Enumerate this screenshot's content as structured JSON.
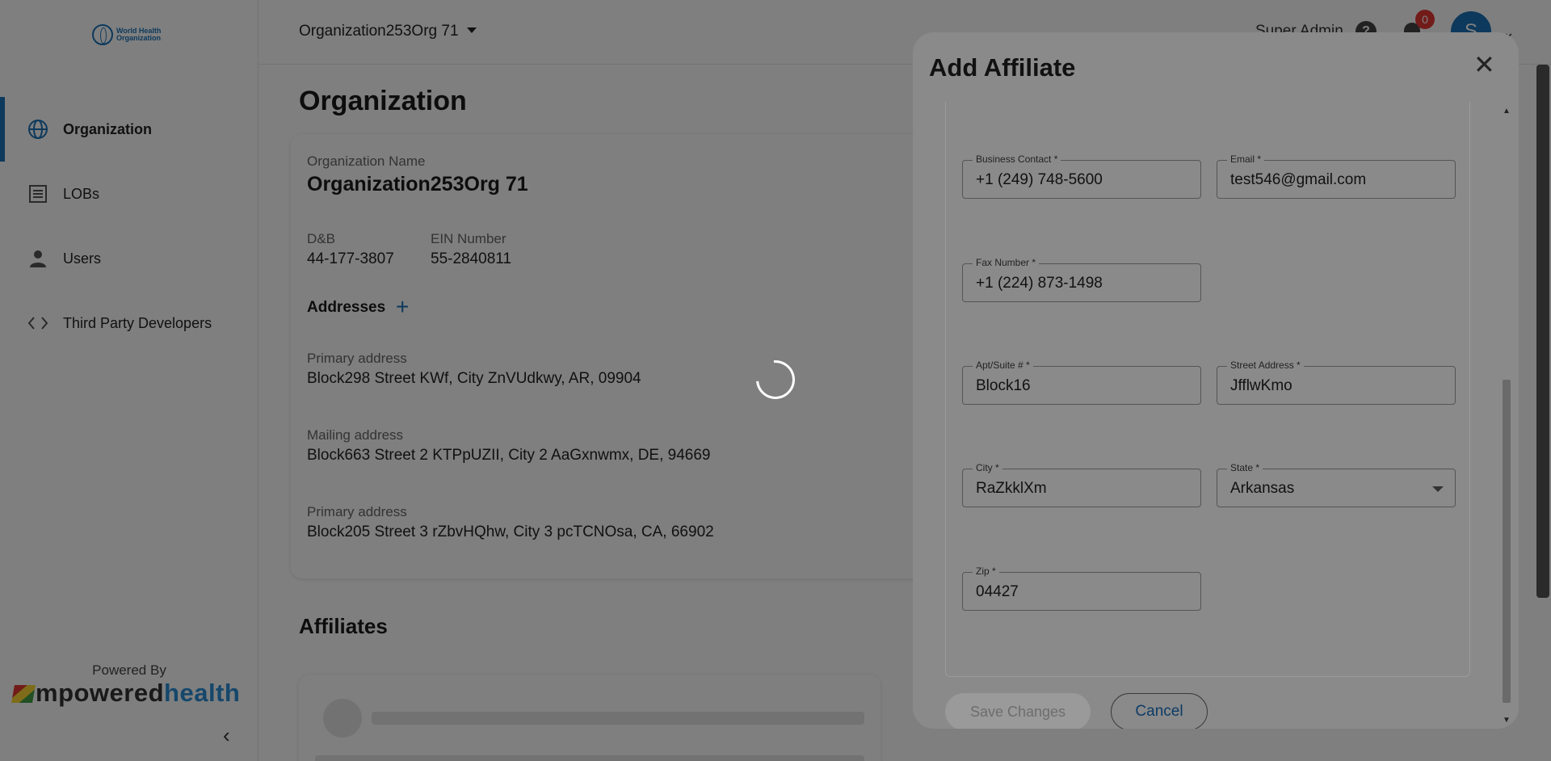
{
  "sidebar": {
    "logo_text": "World Health Organization",
    "items": [
      {
        "label": "Organization",
        "icon": "globe-icon",
        "active": true
      },
      {
        "label": "LOBs",
        "icon": "list-icon",
        "active": false
      },
      {
        "label": "Users",
        "icon": "user-icon",
        "active": false
      },
      {
        "label": "Third Party Developers",
        "icon": "code-icon",
        "active": false
      }
    ],
    "powered_by": "Powered By",
    "brand_m": "mpowered",
    "brand_h": "health",
    "collapse_icon": "‹"
  },
  "topbar": {
    "org_select": "Organization253Org 71",
    "role": "Super Admin",
    "help_icon": "?",
    "notifications_count": "0",
    "avatar_initial": "S",
    "avatar_caret": "⌄"
  },
  "main": {
    "page_title": "Organization",
    "org_name_label": "Organization Name",
    "org_name": "Organization253Org 71",
    "dnb_label": "D&B",
    "dnb": "44-177-3807",
    "ein_label": "EIN Number",
    "ein": "55-2840811",
    "addresses_title": "Addresses",
    "add_icon": "+",
    "addresses": [
      {
        "type": "Primary address",
        "value": "Block298 Street KWf, City ZnVUdkwy, AR, 09904"
      },
      {
        "type": "Mailing address",
        "value": "Block663 Street 2 KTPpUZII, City 2 AaGxnwmx, DE, 94669"
      },
      {
        "type": "Primary address",
        "value": "Block205 Street 3 rZbvHQhw, City 3 pcTCNOsa, CA, 66902"
      }
    ],
    "affiliates_title": "Affiliates"
  },
  "modal": {
    "title": "Add Affiliate",
    "close_icon": "✕",
    "fields": {
      "business_contact": {
        "label": "Business Contact *",
        "value": "+1 (249) 748-5600"
      },
      "email": {
        "label": "Email *",
        "value": "test546@gmail.com"
      },
      "fax": {
        "label": "Fax Number *",
        "value": "+1 (224) 873-1498"
      },
      "apt": {
        "label": "Apt/Suite # *",
        "value": "Block16"
      },
      "street": {
        "label": "Street Address *",
        "value": "JfflwKmo"
      },
      "city": {
        "label": "City *",
        "value": "RaZkklXm"
      },
      "state": {
        "label": "State *",
        "value": "Arkansas"
      },
      "zip": {
        "label": "Zip *",
        "value": "04427"
      }
    },
    "save_label": "Save Changes",
    "cancel_label": "Cancel",
    "scroll_up": "▲",
    "scroll_down": "▼"
  }
}
